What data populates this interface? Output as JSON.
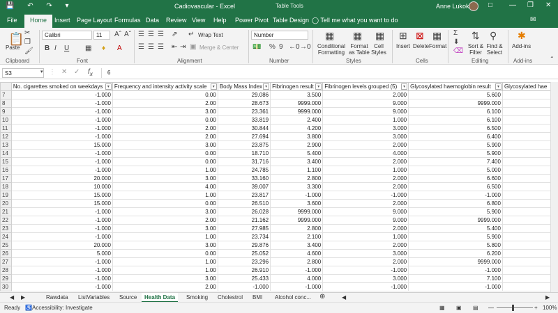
{
  "titlebar": {
    "title": "Cadiovascular  -  Excel",
    "tools": "Table Tools",
    "user": "Anne Lukoko"
  },
  "tabs": [
    "File",
    "Home",
    "Insert",
    "Page Layout",
    "Formulas",
    "Data",
    "Review",
    "View",
    "Help",
    "Power Pivot",
    "Table Design"
  ],
  "tell_me": "Tell me what you want to do",
  "ribbon": {
    "clipboard_label": "Clipboard",
    "paste": "Paste",
    "font_label": "Font",
    "font_name": "Calibri",
    "font_size": "11",
    "alignment_label": "Alignment",
    "wrap_text": "Wrap Text",
    "merge_center": "Merge & Center",
    "number_label": "Number",
    "number_format": "Number",
    "styles_label": "Styles",
    "conditional_formatting": "Conditional Formatting",
    "format_as_table": "Format as Table",
    "cell_styles": "Cell Styles",
    "cells_label": "Cells",
    "insert": "Insert",
    "delete": "Delete",
    "format": "Format",
    "editing_label": "Editing",
    "sort_filter": "Sort & Filter",
    "find_select": "Find & Select",
    "addins": "Add-ins",
    "addins_label": "Add-ins"
  },
  "formula": {
    "name_box": "S3",
    "content": "6"
  },
  "headers": [
    "No. cigarettes smoked on weekdays",
    "Frequency and intensity activity scale",
    "Body Mass Index",
    "Fibrinogen result",
    "Fibrinogen levels grouped (5)",
    "Glycosylated haemoglobin result",
    "Glycosylated hae"
  ],
  "rows": [
    {
      "n": "7",
      "v": [
        "-1.000",
        "0.00",
        "29.086",
        "3.500",
        "2.000",
        "5.600",
        ""
      ]
    },
    {
      "n": "8",
      "v": [
        "-1.000",
        "2.00",
        "28.673",
        "9999.000",
        "9.000",
        "9999.000",
        ""
      ]
    },
    {
      "n": "9",
      "v": [
        "-1.000",
        "3.00",
        "23.361",
        "9999.000",
        "9.000",
        "6.100",
        ""
      ]
    },
    {
      "n": "10",
      "v": [
        "-1.000",
        "0.00",
        "33.819",
        "2.400",
        "1.000",
        "6.100",
        ""
      ]
    },
    {
      "n": "11",
      "v": [
        "-1.000",
        "2.00",
        "30.844",
        "4.200",
        "3.000",
        "6.500",
        ""
      ]
    },
    {
      "n": "12",
      "v": [
        "-1.000",
        "2.00",
        "27.694",
        "3.800",
        "3.000",
        "6.400",
        ""
      ]
    },
    {
      "n": "13",
      "v": [
        "15.000",
        "3.00",
        "23.875",
        "2.900",
        "2.000",
        "5.900",
        ""
      ]
    },
    {
      "n": "14",
      "v": [
        "-1.000",
        "0.00",
        "18.710",
        "5.400",
        "4.000",
        "5.900",
        ""
      ]
    },
    {
      "n": "15",
      "v": [
        "-1.000",
        "0.00",
        "31.716",
        "3.400",
        "2.000",
        "7.400",
        ""
      ]
    },
    {
      "n": "16",
      "v": [
        "-1.000",
        "1.00",
        "24.785",
        "1.100",
        "1.000",
        "5.000",
        ""
      ]
    },
    {
      "n": "17",
      "v": [
        "20.000",
        "3.00",
        "33.160",
        "2.800",
        "2.000",
        "6.600",
        ""
      ]
    },
    {
      "n": "18",
      "v": [
        "10.000",
        "4.00",
        "39.007",
        "3.300",
        "2.000",
        "6.500",
        ""
      ]
    },
    {
      "n": "19",
      "v": [
        "15.000",
        "1.00",
        "23.817",
        "-1.000",
        "-1.000",
        "-1.000",
        ""
      ]
    },
    {
      "n": "20",
      "v": [
        "15.000",
        "0.00",
        "26.510",
        "3.600",
        "2.000",
        "6.800",
        ""
      ]
    },
    {
      "n": "21",
      "v": [
        "-1.000",
        "3.00",
        "26.028",
        "9999.000",
        "9.000",
        "5.900",
        ""
      ]
    },
    {
      "n": "22",
      "v": [
        "-1.000",
        "2.00",
        "21.162",
        "9999.000",
        "9.000",
        "9999.000",
        ""
      ]
    },
    {
      "n": "23",
      "v": [
        "-1.000",
        "3.00",
        "27.985",
        "2.800",
        "2.000",
        "5.400",
        ""
      ]
    },
    {
      "n": "24",
      "v": [
        "-1.000",
        "1.00",
        "23.734",
        "2.100",
        "1.000",
        "5.900",
        ""
      ]
    },
    {
      "n": "25",
      "v": [
        "20.000",
        "3.00",
        "29.876",
        "3.400",
        "2.000",
        "5.800",
        ""
      ]
    },
    {
      "n": "26",
      "v": [
        "5.000",
        "0.00",
        "25.052",
        "4.600",
        "3.000",
        "6.200",
        ""
      ]
    },
    {
      "n": "27",
      "v": [
        "-1.000",
        "1.00",
        "23.296",
        "2.800",
        "2.000",
        "9999.000",
        ""
      ]
    },
    {
      "n": "28",
      "v": [
        "-1.000",
        "1.00",
        "26.910",
        "-1.000",
        "-1.000",
        "-1.000",
        ""
      ]
    },
    {
      "n": "29",
      "v": [
        "-1.000",
        "3.00",
        "25.433",
        "4.000",
        "3.000",
        "7.100",
        ""
      ]
    },
    {
      "n": "30",
      "v": [
        "-1.000",
        "2.00",
        "-1.000",
        "-1.000",
        "-1.000",
        "-1.000",
        ""
      ]
    }
  ],
  "sheet_tabs": [
    "Rawdata",
    "ListVariables",
    "Source",
    "Health Data",
    "Smoking",
    "Cholestrol",
    "BMI",
    "Alcohol conc..."
  ],
  "active_sheet": "Health Data",
  "status": {
    "ready": "Ready",
    "accessibility": "Accessibility: Investigate",
    "zoom": "100%"
  }
}
